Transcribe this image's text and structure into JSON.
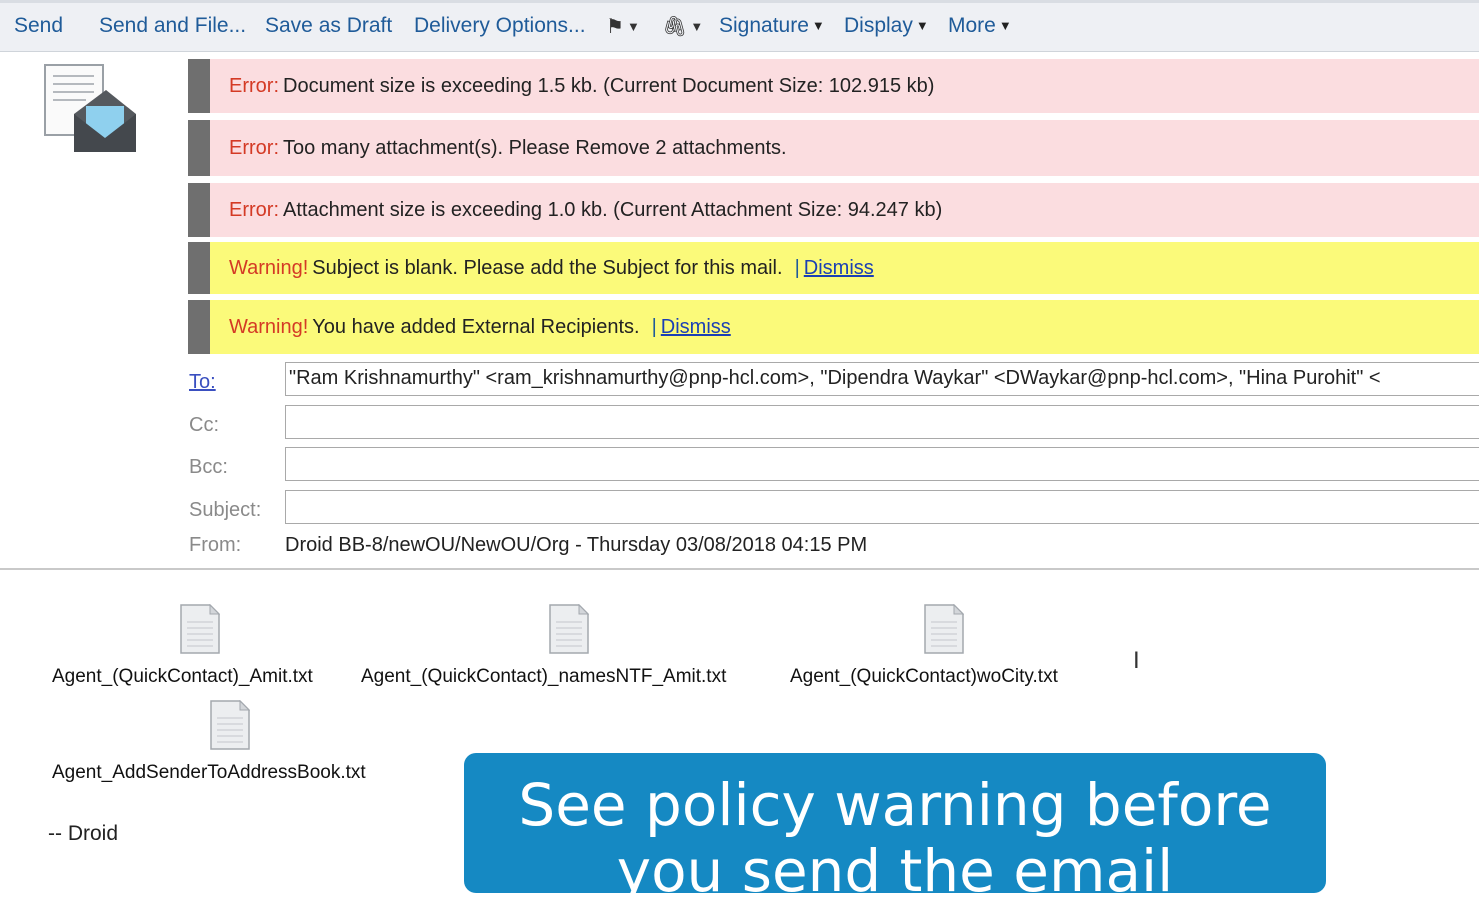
{
  "toolbar": {
    "send": "Send",
    "send_and_file": "Send and File...",
    "save_as_draft": "Save as Draft",
    "delivery_options": "Delivery Options...",
    "signature": "Signature",
    "display": "Display",
    "more": "More"
  },
  "messages": {
    "error_tag": "Error:",
    "warning_tag": "Warning!",
    "err1": "Document size is exceeding 1.5 kb. (Current Document Size: 102.915 kb)",
    "err2": "Too many attachment(s). Please Remove 2 attachments.",
    "err3": "Attachment size is exceeding 1.0 kb. (Current Attachment Size: 94.247 kb)",
    "warn1": "Subject is blank. Please add the Subject for this mail.",
    "warn2": "You have added External Recipients.",
    "separator": "|",
    "dismiss": "Dismiss"
  },
  "header": {
    "to_label": "To:",
    "cc_label": "Cc:",
    "bcc_label": "Bcc:",
    "subject_label": "Subject:",
    "from_label": "From:",
    "to_value": "\"Ram Krishnamurthy\" <ram_krishnamurthy@pnp-hcl.com>, \"Dipendra Waykar\" <DWaykar@pnp-hcl.com>, \"Hina Purohit\" <",
    "cc_value": "",
    "bcc_value": "",
    "subject_value": "",
    "from_value": "Droid BB-8/newOU/NewOU/Org - Thursday 03/08/2018 04:15 PM"
  },
  "attachments": [
    "Agent_(QuickContact)_Amit.txt",
    "Agent_(QuickContact)_namesNTF_Amit.txt",
    "Agent_(QuickContact)woCity.txt",
    "Agent_AddSenderToAddressBook.txt"
  ],
  "body": {
    "signature": "-- Droid"
  },
  "overlay": {
    "line1": "See policy warning before",
    "line2": "you send the email"
  }
}
